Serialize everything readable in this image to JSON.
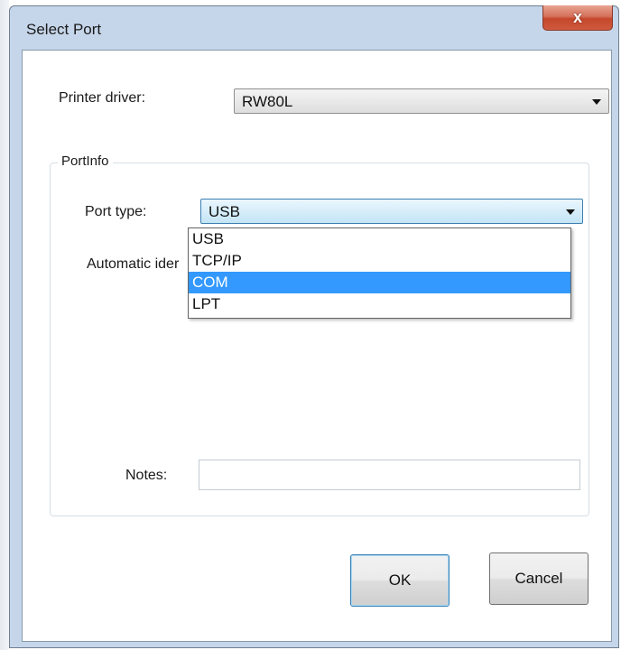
{
  "window": {
    "title": "Select Port",
    "close_glyph": "x"
  },
  "printer_driver": {
    "label": "Printer driver:",
    "value": "RW80L"
  },
  "port_info": {
    "legend": "PortInfo",
    "port_type_label": "Port type:",
    "port_type_value": "USB",
    "port_type_options": [
      "USB",
      "TCP/IP",
      "COM",
      "LPT"
    ],
    "highlighted_option": "COM",
    "auto_identify_label": "Automatic ider",
    "notes_label": "Notes:",
    "notes_value": ""
  },
  "buttons": {
    "ok_label": "OK",
    "cancel_label": "Cancel"
  },
  "colors": {
    "selection": "#3399ff",
    "close_button": "#c4472b",
    "frame": "#c6d6ea"
  }
}
